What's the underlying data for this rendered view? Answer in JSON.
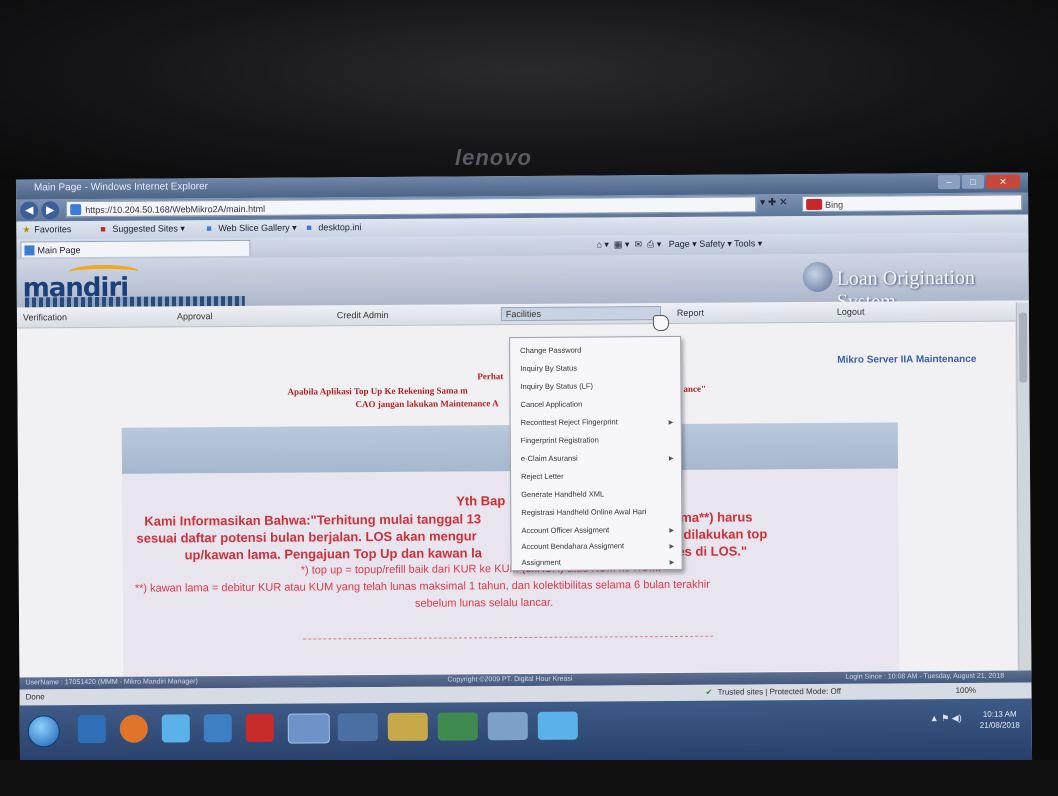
{
  "brand": "lenovo",
  "window": {
    "title": "Main Page - Windows Internet Explorer"
  },
  "browser": {
    "url": "https://10.204.50.168/WebMikro2A/main.html",
    "address_tools": "▾ ✚ ✕",
    "search_placeholder": "Bing",
    "favorites_label": "Favorites",
    "suggested_sites": "Suggested Sites ▾",
    "web_slice": "Web Slice Gallery ▾",
    "desktop_ini": "desktop.ini",
    "tab_title": "Main Page",
    "commandbar": "Page ▾   Safety ▾   Tools ▾"
  },
  "banner": {
    "logo": "mandiri",
    "system_name": "Loan Origination System"
  },
  "menu": {
    "verification": "Verification",
    "approval": "Approval",
    "credit_admin": "Credit Admin",
    "facilities": "Facilities",
    "report": "Report",
    "logout": "Logout"
  },
  "dropdown": {
    "items": [
      "Change Password",
      "Inquiry By Status",
      "Inquiry By Status (LF)",
      "Cancel Application",
      "Reconttest Reject Fingerprint",
      "Fingerprint Registration",
      "e-Claim Asuransi",
      "Reject Letter",
      "Generate Handheld XML",
      "Registrasi Handheld Online Awal Hari",
      "Account Officer Assigment",
      "Account Bendahara Assigment",
      "Assignment"
    ]
  },
  "page": {
    "server_label": "Mikro Server IIA",
    "maintenance_link": "Maintenance",
    "perhatian": "Perhat",
    "notice_line1": "Apabila Aplikasi Top Up Ke Rekening Sama m",
    "notice_line1_end": "ance\"",
    "notice_line2": "CAO jangan lakukan Maintenance A",
    "greeting": "Yth Bap",
    "line1a": "Kami Informasikan Bahwa:\"Terhitung mulai tanggal 13",
    "line1b": "*) dan kawan lama**) harus",
    "line2a": "sesuai daftar potensi bulan berjalan. LOS akan mengur",
    "line2b": "an yang dapat dilakukan top",
    "line3a": "up/kawan lama. Pengajuan Top Up dan kawan la",
    "line3b": "pat diproses di LOS.\"",
    "footnote1": "*) top up = topup/refill baik dari KUR ke KUM (exKUR) atau KUM ke KUM.",
    "footnote2": "**) kawan lama = debitur KUR atau KUM yang telah lunas maksimal 1 tahun, dan kolektibilitas selama 6 bulan terakhir",
    "footnote3": "sebelum lunas selalu lancar."
  },
  "status": {
    "user": "UserName : 17051420 (MMM - Mikro Mandiri Manager)",
    "copyright": "Copyright ©2009 PT. Digital Hour Kreasi",
    "right": "Login Since : 10:08 AM - Tuesday, August 21, 2018",
    "done": "Done",
    "zone": "Trusted sites | Protected Mode: Off",
    "zoom": "100%"
  },
  "taskbar": {
    "time": "10:13 AM",
    "date": "21/08/2018"
  },
  "colors": {
    "accent_red": "#d0303a",
    "link_blue": "#3a5fb0",
    "taskbar": "#26406a"
  }
}
